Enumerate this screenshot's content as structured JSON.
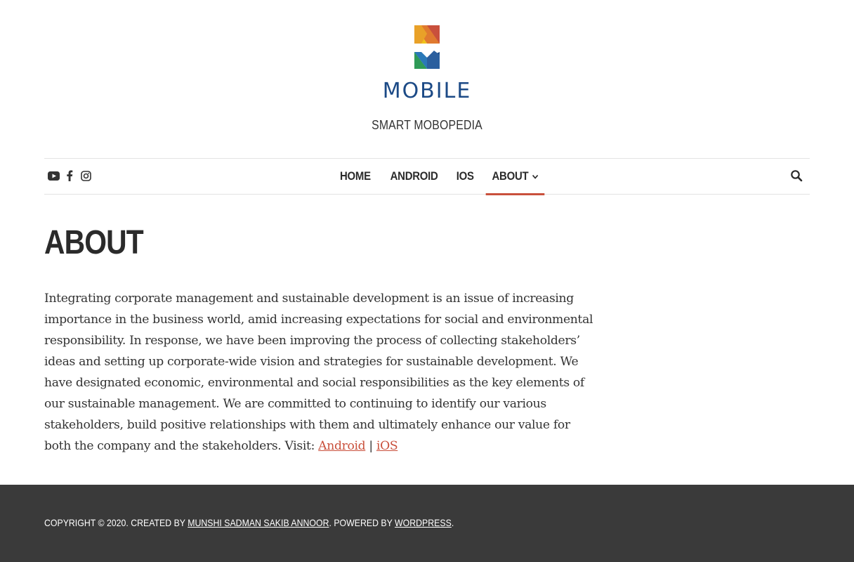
{
  "site": {
    "logo_text": "MOBILE",
    "tagline": "SMART MOBOPEDIA"
  },
  "social": [
    {
      "name": "youtube-icon"
    },
    {
      "name": "facebook-icon"
    },
    {
      "name": "instagram-icon"
    }
  ],
  "nav": {
    "items": [
      {
        "label": "HOME"
      },
      {
        "label": "ANDROID"
      },
      {
        "label": "IOS"
      },
      {
        "label": "ABOUT",
        "active": true,
        "has_dropdown": true
      }
    ],
    "search_icon": "search-icon"
  },
  "page": {
    "title": "ABOUT",
    "body": "Integrating corporate management and sustainable development is an issue of increasing importance in the business world, amid increasing expectations for social and environmental responsibility. In response, we have been improving the process of collecting stakeholders’ ideas and setting up corporate-wide vision and strategies for sustainable development. We have designated economic, environmental and social responsibilities as the key elements of our sustainable management. We are committed to continuing to identify our various stakeholders, build positive relationships with them and ultimately enhance our value for both the company and the stakeholders. Visit: ",
    "link_android": "Android",
    "separator": " | ",
    "link_ios": "iOS"
  },
  "footer": {
    "prefix": "COPYRIGHT © 2020. CREATED BY ",
    "author_link": "MUNSHI SADMAN SAKIB ANNOOR",
    "middle": ". POWERED BY ",
    "wp_link": "WORDPRESS",
    "suffix": "."
  },
  "colors": {
    "accent": "#c9503c",
    "footer_bg": "#3a3a3a",
    "logo_blue": "#1c4a86"
  }
}
